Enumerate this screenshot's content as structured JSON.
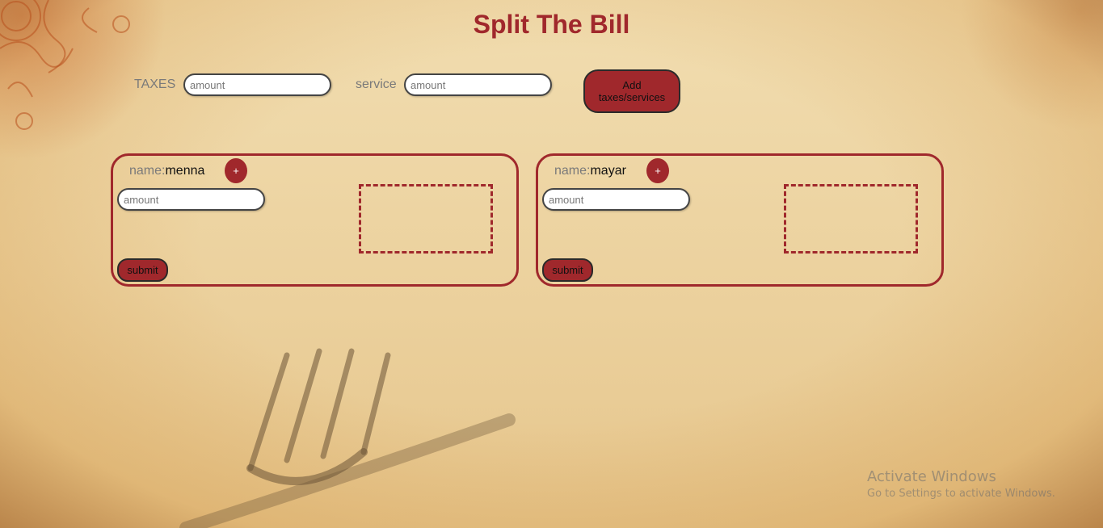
{
  "page": {
    "title": "Split The Bill"
  },
  "charges": {
    "taxes_label": "TAXES",
    "taxes_placeholder": "amount",
    "taxes_value": "",
    "service_label": "service",
    "service_placeholder": "amount",
    "service_value": "",
    "add_button_label": "Add taxes/services"
  },
  "people": [
    {
      "name_prefix": "name:",
      "name": "menna",
      "add_label": "+",
      "amount_placeholder": "amount",
      "amount_value": "",
      "submit_label": "submit"
    },
    {
      "name_prefix": "name:",
      "name": "mayar",
      "add_label": "+",
      "amount_placeholder": "amount",
      "amount_value": "",
      "submit_label": "submit"
    }
  ],
  "watermark": {
    "title": "Activate Windows",
    "subtitle": "Go to Settings to activate Windows."
  },
  "colors": {
    "accent": "#a0282c",
    "background": "#ecd29f",
    "label_gray": "#7a7a7a"
  }
}
